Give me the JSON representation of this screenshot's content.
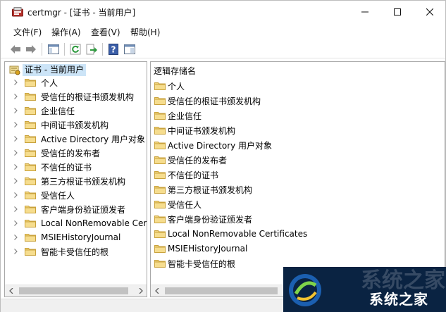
{
  "window": {
    "title": "certmgr - [证书 - 当前用户]"
  },
  "menu": {
    "items": [
      "文件(F)",
      "操作(A)",
      "查看(V)",
      "帮助(H)"
    ]
  },
  "toolbar": {
    "icons": [
      "back-arrow-icon",
      "forward-arrow-icon",
      "show-hide-console-tree-icon",
      "refresh-icon",
      "export-list-icon",
      "help-icon",
      "properties-pane-icon"
    ]
  },
  "tree": {
    "root_label": "证书 - 当前用户",
    "items": [
      "个人",
      "受信任的根证书颁发机构",
      "企业信任",
      "中间证书颁发机构",
      "Active Directory 用户对象",
      "受信任的发布者",
      "不信任的证书",
      "第三方根证书颁发机构",
      "受信任人",
      "客户端身份验证颁发者",
      "Local NonRemovable Cert",
      "MSIEHistoryJournal",
      "智能卡受信任的根"
    ]
  },
  "list": {
    "header": "逻辑存储名",
    "items": [
      "个人",
      "受信任的根证书颁发机构",
      "企业信任",
      "中间证书颁发机构",
      "Active Directory 用户对象",
      "受信任的发布者",
      "不信任的证书",
      "第三方根证书颁发机构",
      "受信任人",
      "客户端身份验证颁发者",
      "Local NonRemovable Certificates",
      "MSIEHistoryJournal",
      "智能卡受信任的根"
    ]
  },
  "watermark": {
    "text": "系统之家",
    "ghost": "系统之家"
  },
  "colors": {
    "selection": "#cce4f7",
    "folder": "#e8c66a",
    "watermark_bg": "#0a2342"
  }
}
